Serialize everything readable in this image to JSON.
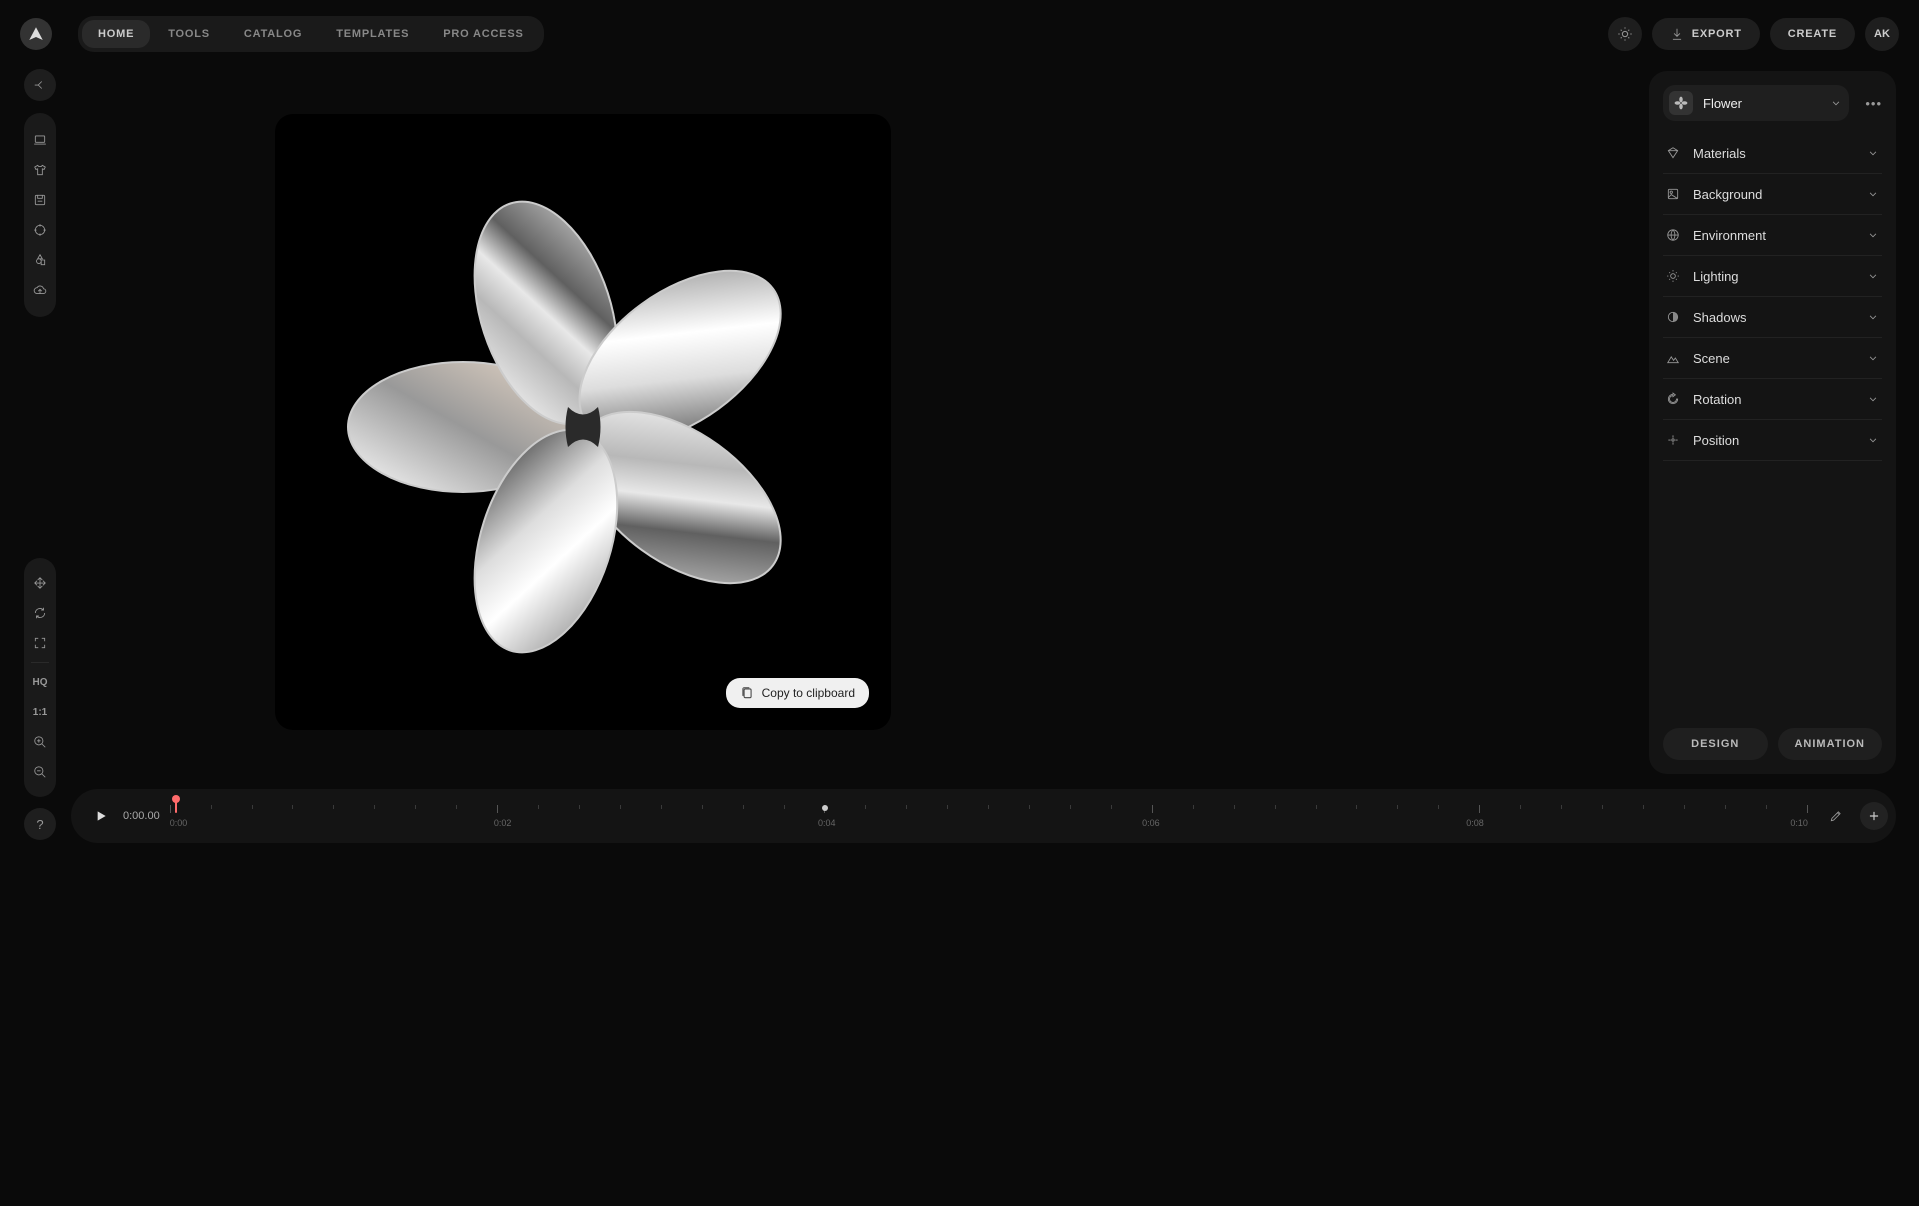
{
  "nav": {
    "items": [
      "HOME",
      "TOOLS",
      "CATALOG",
      "TEMPLATES",
      "PRO ACCESS"
    ],
    "active_index": 0
  },
  "header": {
    "export_label": "EXPORT",
    "create_label": "CREATE",
    "avatar_initials": "AK"
  },
  "left_tools_group1": [
    "laptop-icon",
    "shirt-icon",
    "save-icon",
    "crosshair-icon",
    "shapes-icon",
    "cloud-upload-icon"
  ],
  "left_tools_group2": {
    "move": "move-icon",
    "refresh": "refresh-icon",
    "expand": "expand-icon",
    "hq_label": "HQ",
    "ratio_label": "1:1",
    "zoom_in": "zoom-in-icon",
    "zoom_out": "zoom-out-icon"
  },
  "canvas": {
    "copy_label": "Copy to clipboard"
  },
  "object": {
    "name": "Flower"
  },
  "sections": [
    {
      "icon": "bucket-icon",
      "label": "Materials"
    },
    {
      "icon": "image-icon",
      "label": "Background"
    },
    {
      "icon": "globe-icon",
      "label": "Environment"
    },
    {
      "icon": "sun-icon",
      "label": "Lighting"
    },
    {
      "icon": "shadow-icon",
      "label": "Shadows"
    },
    {
      "icon": "mountain-icon",
      "label": "Scene"
    },
    {
      "icon": "rotate-icon",
      "label": "Rotation"
    },
    {
      "icon": "position-icon",
      "label": "Position"
    }
  ],
  "panel_tabs": {
    "design": "DESIGN",
    "animation": "ANIMATION"
  },
  "timeline": {
    "current_time": "0:00.00",
    "labels": [
      "0:00",
      "0:02",
      "0:04",
      "0:06",
      "0:08",
      "0:10"
    ],
    "playhead_position_pct": 0.3,
    "keyframe_position_pct": 40
  },
  "help_label": "?"
}
